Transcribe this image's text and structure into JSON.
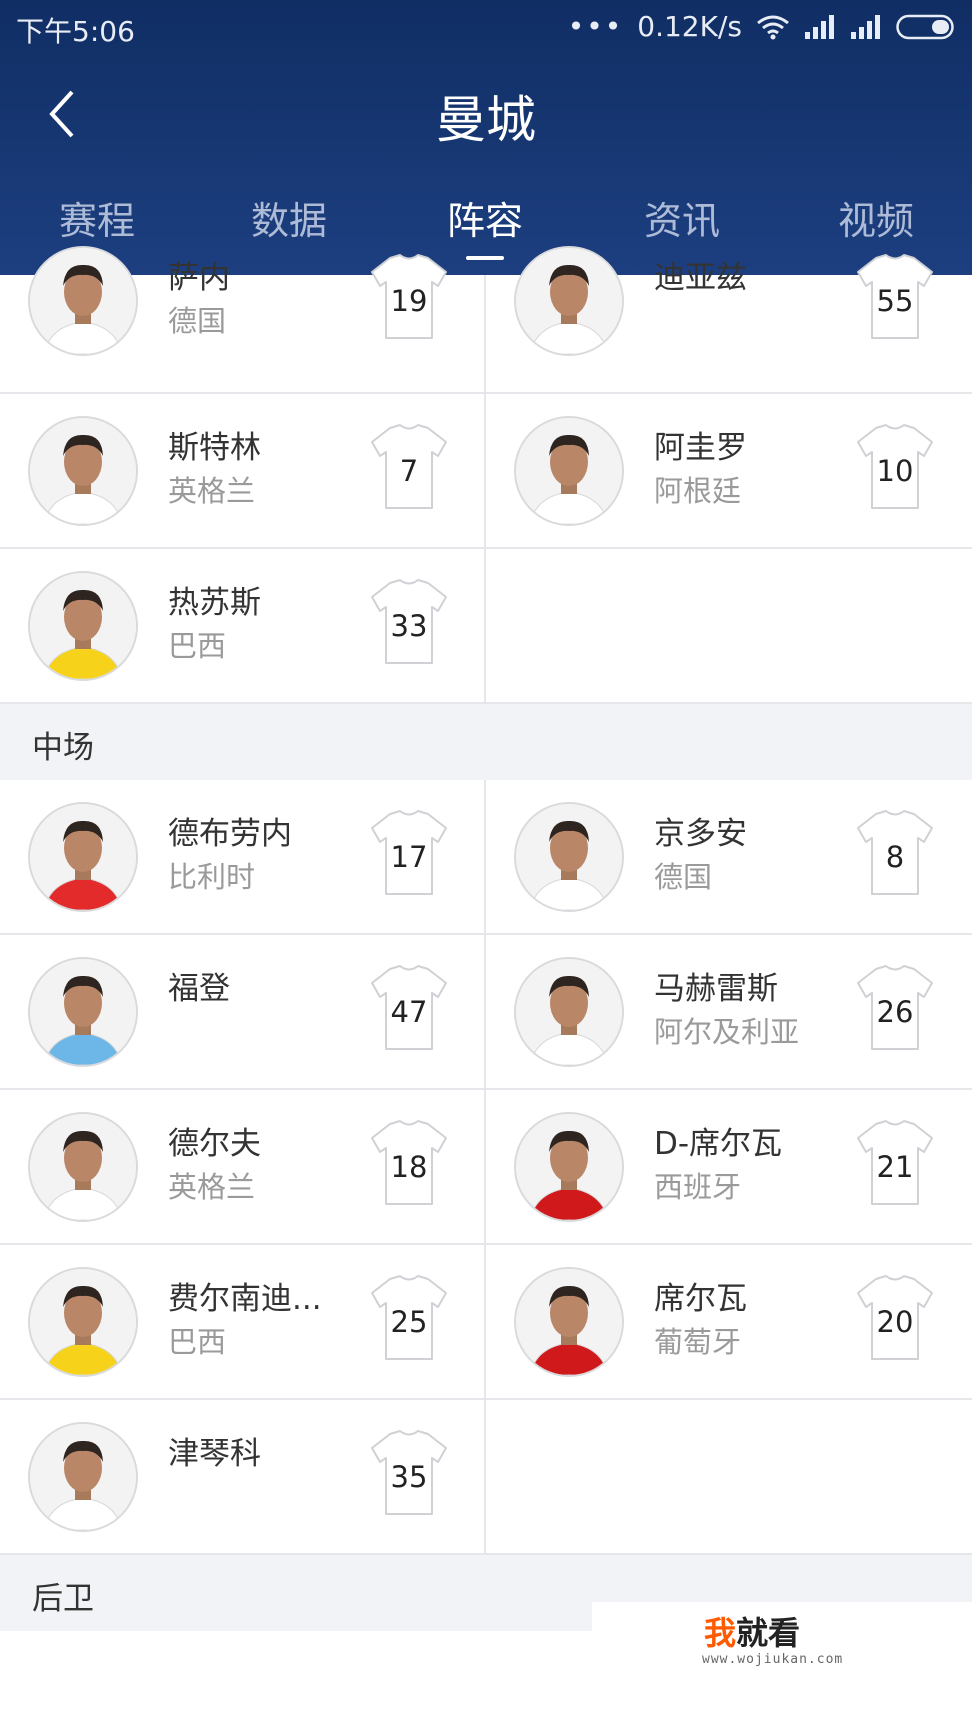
{
  "status_bar": {
    "time": "下午5:06",
    "dots": "•••",
    "speed": "0.12K/s"
  },
  "header": {
    "title": "曼城"
  },
  "tabs": [
    {
      "label": "赛程",
      "active": false
    },
    {
      "label": "数据",
      "active": false
    },
    {
      "label": "阵容",
      "active": true
    },
    {
      "label": "资讯",
      "active": false
    },
    {
      "label": "视频",
      "active": false
    }
  ],
  "forwards": [
    [
      {
        "name": "萨内",
        "nation": "德国",
        "number": "19",
        "kit": "#ffffff"
      },
      {
        "name": "迪亚兹",
        "nation": "",
        "number": "55",
        "kit": "#ffffff"
      }
    ],
    [
      {
        "name": "斯特林",
        "nation": "英格兰",
        "number": "7",
        "kit": "#ffffff"
      },
      {
        "name": "阿圭罗",
        "nation": "阿根廷",
        "number": "10",
        "kit": "#ffffff"
      }
    ],
    [
      {
        "name": "热苏斯",
        "nation": "巴西",
        "number": "33",
        "kit": "#f6d21b"
      }
    ]
  ],
  "sections": {
    "midfield": "中场",
    "defence": "后卫"
  },
  "midfielders": [
    [
      {
        "name": "德布劳内",
        "nation": "比利时",
        "number": "17",
        "kit": "#e32b2b"
      },
      {
        "name": "京多安",
        "nation": "德国",
        "number": "8",
        "kit": "#ffffff"
      }
    ],
    [
      {
        "name": "福登",
        "nation": "",
        "number": "47",
        "kit": "#6cb6e8"
      },
      {
        "name": "马赫雷斯",
        "nation": "阿尔及利亚",
        "number": "26",
        "kit": "#ffffff"
      }
    ],
    [
      {
        "name": "德尔夫",
        "nation": "英格兰",
        "number": "18",
        "kit": "#ffffff"
      },
      {
        "name": "D-席尔瓦",
        "nation": "西班牙",
        "number": "21",
        "kit": "#d0191b"
      }
    ],
    [
      {
        "name": "费尔南迪...",
        "nation": "巴西",
        "number": "25",
        "kit": "#f6d21b"
      },
      {
        "name": "席尔瓦",
        "nation": "葡萄牙",
        "number": "20",
        "kit": "#d0191b"
      }
    ],
    [
      {
        "name": "津琴科",
        "nation": "",
        "number": "35",
        "kit": "#ffffff"
      }
    ]
  ],
  "watermark": {
    "brand_orange": "我",
    "brand_rest": "就看",
    "url": "www.wojiukan.com"
  },
  "colors": {
    "header": "#17356f",
    "section_bg": "#f2f3f6",
    "watermark_orange": "#ff5a00"
  }
}
